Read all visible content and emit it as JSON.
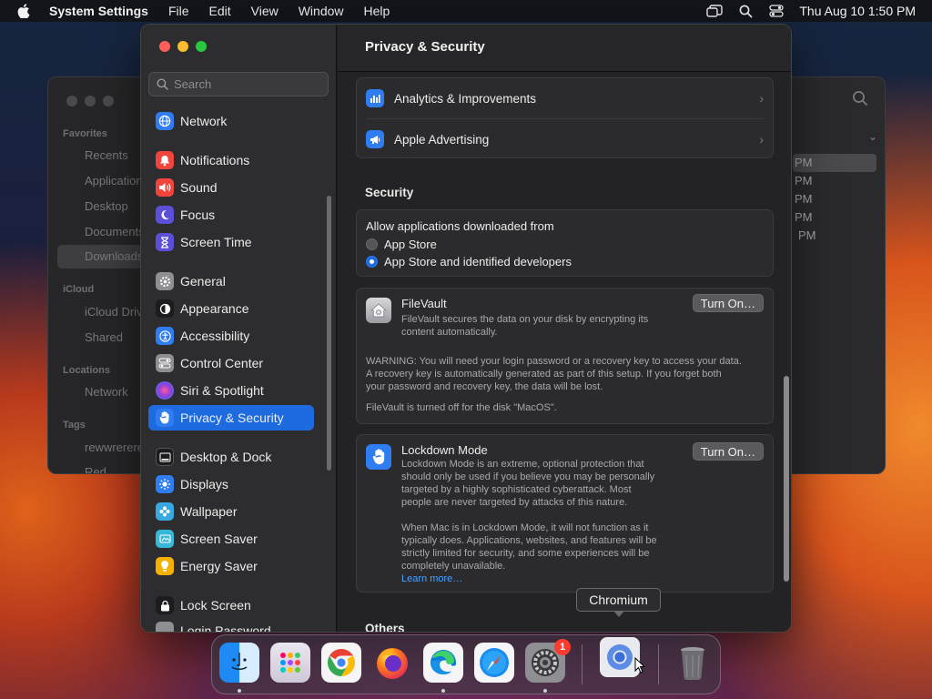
{
  "menubar": {
    "app_name": "System Settings",
    "menus": [
      "File",
      "Edit",
      "View",
      "Window",
      "Help"
    ],
    "clock": "Thu Aug 10  1:50 PM",
    "status_icons": [
      "screen-mirroring-icon",
      "spotlight-search-icon",
      "control-center-icon"
    ]
  },
  "finder": {
    "favorites_header": "Favorites",
    "favorites": [
      "Recents",
      "Applications",
      "Desktop",
      "Documents",
      "Downloads"
    ],
    "icloud_header": "iCloud",
    "icloud": [
      "iCloud Drive",
      "Shared"
    ],
    "locations_header": "Locations",
    "locations": [
      "Network"
    ],
    "tags_header": "Tags",
    "tags": [
      "rewwrerere",
      "Red"
    ],
    "time_rows": [
      "PM",
      "PM",
      "PM",
      "PM",
      "PM"
    ]
  },
  "settings": {
    "search_placeholder": "Search",
    "sidebar": [
      {
        "label": "Network",
        "icon": "globe-icon",
        "color": "#2f7df0"
      },
      {
        "label": "Notifications",
        "icon": "bell-icon",
        "color": "#f0453c"
      },
      {
        "label": "Sound",
        "icon": "speaker-icon",
        "color": "#f0453c"
      },
      {
        "label": "Focus",
        "icon": "moon-icon",
        "color": "#5b4fd8"
      },
      {
        "label": "Screen Time",
        "icon": "hourglass-icon",
        "color": "#5b4fd8"
      },
      {
        "label": "General",
        "icon": "gear-icon",
        "color": "#8e8e93"
      },
      {
        "label": "Appearance",
        "icon": "appearance-icon",
        "color": "#1c1c1e"
      },
      {
        "label": "Accessibility",
        "icon": "accessibility-icon",
        "color": "#2f7df0"
      },
      {
        "label": "Control Center",
        "icon": "control-center-icon",
        "color": "#8e8e93"
      },
      {
        "label": "Siri & Spotlight",
        "icon": "siri-icon",
        "color": "#b04ad8"
      },
      {
        "label": "Privacy & Security",
        "icon": "hand-icon",
        "color": "#2f7df0"
      },
      {
        "label": "Desktop & Dock",
        "icon": "dock-icon",
        "color": "#1c1c1e"
      },
      {
        "label": "Displays",
        "icon": "sun-icon",
        "color": "#2f7df0"
      },
      {
        "label": "Wallpaper",
        "icon": "flower-icon",
        "color": "#38a8e0"
      },
      {
        "label": "Screen Saver",
        "icon": "screensaver-icon",
        "color": "#38b8d8"
      },
      {
        "label": "Energy Saver",
        "icon": "battery-icon",
        "color": "#f5b000"
      },
      {
        "label": "Lock Screen",
        "icon": "lock-icon",
        "color": "#1c1c1e"
      },
      {
        "label": "Login Password",
        "icon": "key-icon",
        "color": "#8e8e93"
      }
    ],
    "selected": "Privacy & Security",
    "pane_title": "Privacy & Security",
    "top_rows": [
      {
        "label": "Analytics & Improvements",
        "icon": "chart-icon"
      },
      {
        "label": "Apple Advertising",
        "icon": "megaphone-icon"
      }
    ],
    "security": {
      "title": "Security",
      "allow_label": "Allow applications downloaded from",
      "options": [
        "App Store",
        "App Store and identified developers"
      ],
      "selected_option": "App Store and identified developers"
    },
    "filevault": {
      "title": "FileVault",
      "desc_line1": "FileVault secures the data on your disk by encrypting its",
      "desc_line2": "content automatically.",
      "button": "Turn On…",
      "warning_line1": "WARNING: You will need your login password or a recovery key to access your data.",
      "warning_line2": "A recovery key is automatically generated as part of this setup. If you forget both",
      "warning_line3": "your password and recovery key, the data will be lost.",
      "status": "FileVault is turned off for the disk \"MacOS\"."
    },
    "lockdown": {
      "title": "Lockdown Mode",
      "button": "Turn On…",
      "desc_line1": "Lockdown Mode is an extreme, optional protection that",
      "desc_line2": "should only be used if you believe you may be personally",
      "desc_line3": "targeted by a highly sophisticated cyberattack. Most",
      "desc_line4": "people are never targeted by attacks of this nature.",
      "desc2_line1": "When Mac is in Lockdown Mode, it will not function as it",
      "desc2_line2": "typically does. Applications, websites, and features will be",
      "desc2_line3": "strictly limited for security, and some experiences will be",
      "desc2_line4": "completely unavailable.",
      "link": "Learn more…"
    },
    "others_title": "Others"
  },
  "tooltip": "Chromium",
  "dock": [
    {
      "name": "Finder",
      "icon": "finder-icon",
      "running": true
    },
    {
      "name": "Launchpad",
      "icon": "launchpad-icon",
      "running": false
    },
    {
      "name": "Google Chrome",
      "icon": "chrome-icon",
      "running": false
    },
    {
      "name": "Firefox",
      "icon": "firefox-icon",
      "running": false
    },
    {
      "name": "Microsoft Edge",
      "icon": "edge-icon",
      "running": true
    },
    {
      "name": "Safari",
      "icon": "safari-icon",
      "running": false
    },
    {
      "name": "System Settings",
      "icon": "settings-icon",
      "running": true,
      "badge": "1"
    },
    {
      "name": "Chromium",
      "icon": "chromium-icon",
      "running": false
    },
    {
      "name": "Trash",
      "icon": "trash-icon",
      "running": false
    }
  ]
}
